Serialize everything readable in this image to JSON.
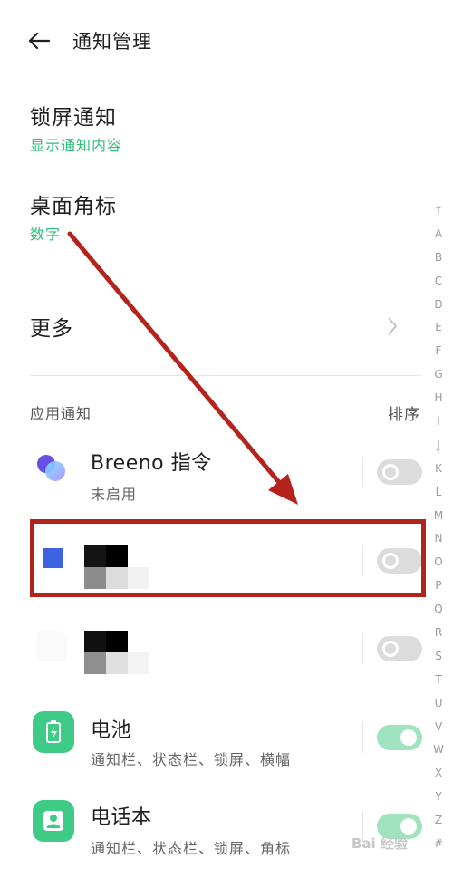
{
  "header": {
    "title": "通知管理"
  },
  "lock_screen": {
    "title": "锁屏通知",
    "value": "显示通知内容"
  },
  "badge": {
    "title": "桌面角标",
    "value": "数字"
  },
  "more": {
    "title": "更多"
  },
  "apps_section": {
    "label": "应用通知",
    "sort_label": "排序"
  },
  "apps": [
    {
      "name": "Breeno 指令",
      "status": "未启用",
      "enabled": false,
      "icon": "breeno-icon"
    },
    {
      "name": "",
      "status": "",
      "enabled": false,
      "icon": "blue-square-app-icon"
    },
    {
      "name": "",
      "status": "",
      "enabled": false,
      "icon": "blank-app-icon"
    },
    {
      "name": "电池",
      "status": "通知栏、状态栏、锁屏、横幅",
      "enabled": true,
      "icon": "battery-icon",
      "icon_color": "#3ecb86"
    },
    {
      "name": "电话本",
      "status": "通知栏、状态栏、锁屏、角标",
      "enabled": true,
      "icon": "contacts-icon",
      "icon_color": "#3ecb86"
    }
  ],
  "alphabet_index": [
    "↑",
    "A",
    "B",
    "C",
    "D",
    "E",
    "F",
    "G",
    "H",
    "I",
    "J",
    "K",
    "L",
    "M",
    "N",
    "O",
    "P",
    "Q",
    "R",
    "S",
    "T",
    "U",
    "V",
    "W",
    "X",
    "Y",
    "Z",
    "#"
  ],
  "annotation": {
    "arrow_color": "#b5231d",
    "box_color": "#b5231d"
  },
  "watermark": "Bai 经验"
}
